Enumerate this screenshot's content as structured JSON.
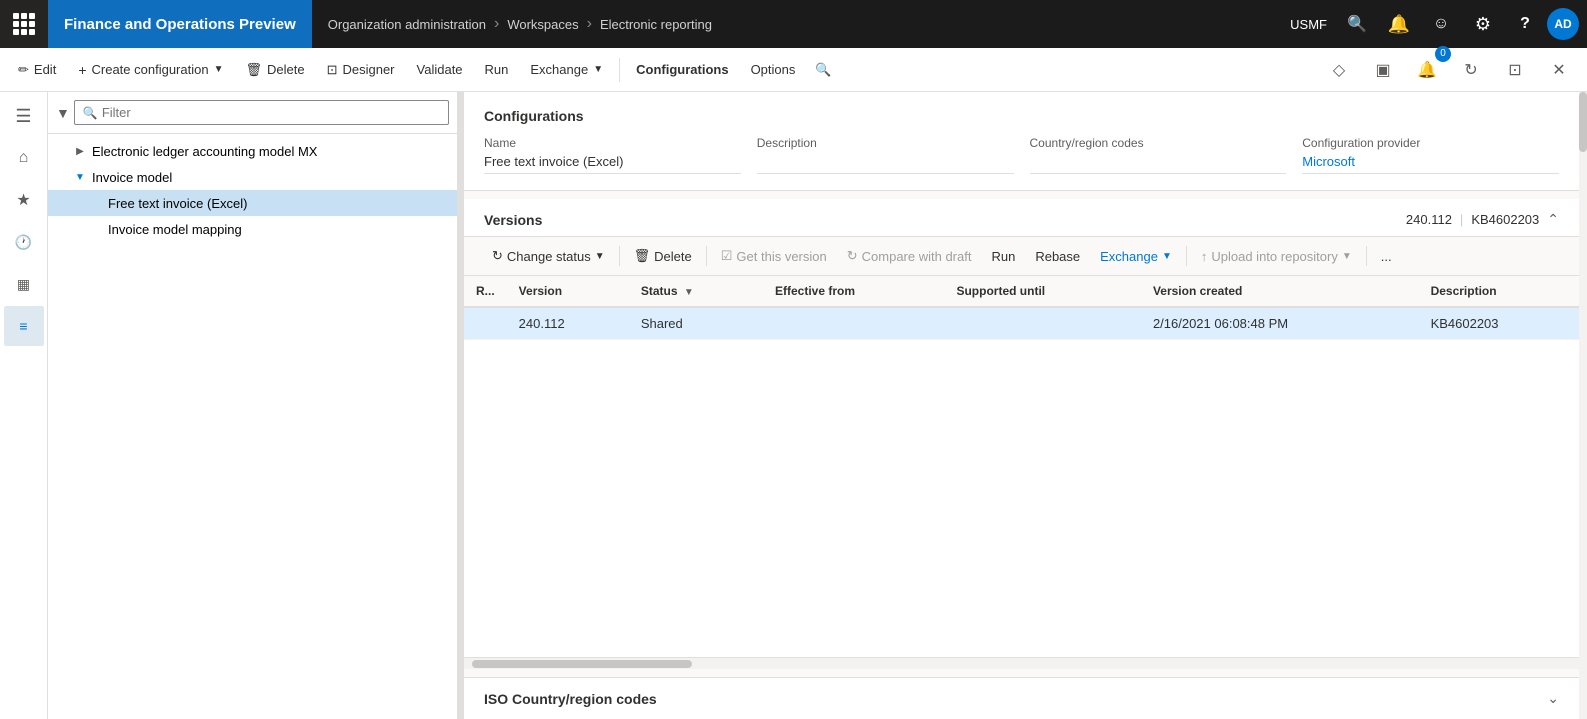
{
  "app": {
    "title": "Finance and Operations Preview",
    "entity": "USMF"
  },
  "breadcrumb": {
    "item1": "Organization administration",
    "item2": "Workspaces",
    "item3": "Electronic reporting"
  },
  "commandBar": {
    "edit": "Edit",
    "createConfiguration": "Create configuration",
    "delete": "Delete",
    "designer": "Designer",
    "validate": "Validate",
    "run": "Run",
    "exchange": "Exchange",
    "configurations": "Configurations",
    "options": "Options"
  },
  "filter": {
    "placeholder": "Filter"
  },
  "treeItems": [
    {
      "id": "electronic-ledger",
      "label": "Electronic ledger accounting model MX",
      "indent": 1,
      "hasExpand": true,
      "expanded": false
    },
    {
      "id": "invoice-model",
      "label": "Invoice model",
      "indent": 1,
      "hasExpand": true,
      "expanded": true
    },
    {
      "id": "free-text-invoice",
      "label": "Free text invoice (Excel)",
      "indent": 2,
      "selected": true
    },
    {
      "id": "invoice-model-mapping",
      "label": "Invoice model mapping",
      "indent": 2
    }
  ],
  "configurationsSection": {
    "title": "Configurations",
    "fields": {
      "name": {
        "label": "Name",
        "value": "Free text invoice (Excel)"
      },
      "description": {
        "label": "Description",
        "value": ""
      },
      "countryRegionCodes": {
        "label": "Country/region codes",
        "value": ""
      },
      "configurationProvider": {
        "label": "Configuration provider",
        "value": "Microsoft"
      }
    }
  },
  "versionsSection": {
    "title": "Versions",
    "versionNumber": "240.112",
    "kb": "KB4602203",
    "toolbar": {
      "changeStatus": "Change status",
      "delete": "Delete",
      "getThisVersion": "Get this version",
      "compareWithDraft": "Compare with draft",
      "run": "Run",
      "rebase": "Rebase",
      "exchange": "Exchange",
      "uploadIntoRepository": "Upload into repository",
      "more": "..."
    },
    "table": {
      "columns": [
        "R...",
        "Version",
        "Status",
        "Effective from",
        "Supported until",
        "Version created",
        "Description"
      ],
      "rows": [
        {
          "r": "",
          "version": "240.112",
          "status": "Shared",
          "effectiveFrom": "",
          "supportedUntil": "",
          "versionCreated": "2/16/2021 06:08:48 PM",
          "description": "KB4602203",
          "selected": true
        }
      ]
    }
  },
  "isoSection": {
    "title": "ISO Country/region codes"
  },
  "icons": {
    "grid": "⊞",
    "hamburger": "☰",
    "home": "⌂",
    "star": "★",
    "clock": "🕐",
    "calendar": "▦",
    "list": "≡",
    "filter": "▼",
    "search": "🔍",
    "bell": "🔔",
    "smiley": "☺",
    "gear": "⚙",
    "help": "?",
    "close": "✕",
    "chevronRight": "›",
    "chevronDown": "⌄",
    "chevronUp": "⌃",
    "expand": "▶",
    "collapse": "▼",
    "edit": "✏",
    "plus": "+",
    "trash": "🗑",
    "designer": "⊞",
    "refresh": "↻",
    "upload": "↑",
    "diamond": "◇",
    "panel": "▣"
  }
}
